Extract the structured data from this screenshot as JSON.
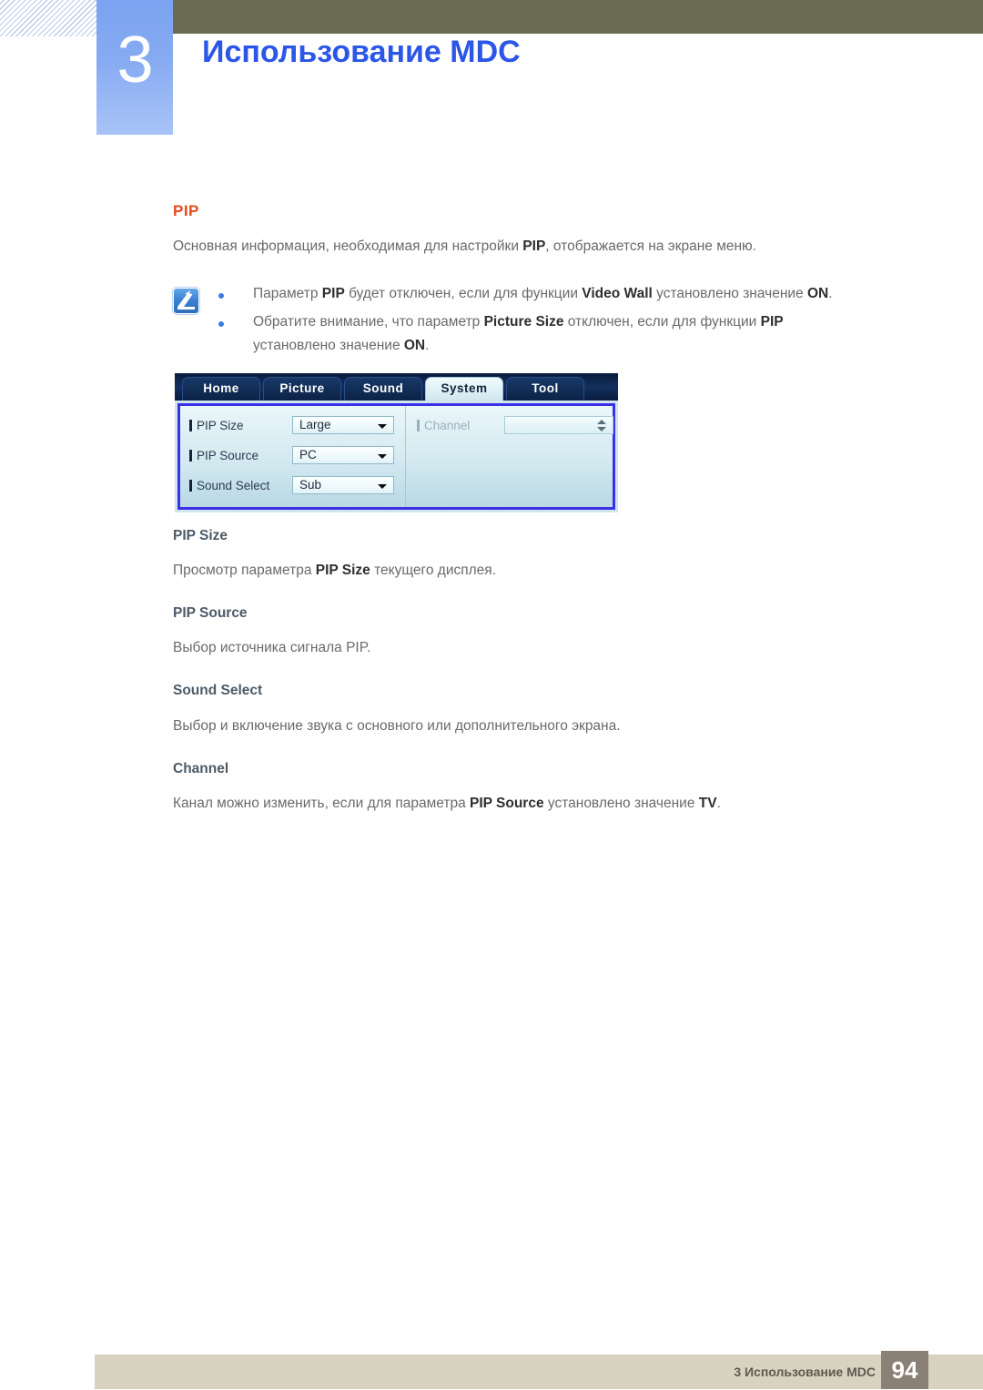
{
  "header": {
    "chapter_number": "3",
    "chapter_title": "Использование MDC",
    "accent_blue": "#2b56e8",
    "olive": "#6b6a52"
  },
  "section": {
    "title": "PIP",
    "title_color": "#e8491c",
    "intro_parts": [
      {
        "text": "Основная информация, необходимая для настройки ",
        "bold": false
      },
      {
        "text": "PIP",
        "bold": true
      },
      {
        "text": ", отображается на экране меню.",
        "bold": false
      }
    ]
  },
  "note": {
    "icon": "note-pen-icon",
    "bullet_color": "#3a7ddf",
    "items": [
      {
        "line1": [
          {
            "text": "Параметр ",
            "bold": false
          },
          {
            "text": "PIP",
            "bold": true
          },
          {
            "text": " будет отключен, если для функции ",
            "bold": false
          },
          {
            "text": "Video Wall",
            "bold": true
          },
          {
            "text": " установлено значение ",
            "bold": false
          },
          {
            "text": "ON",
            "bold": true
          },
          {
            "text": ".",
            "bold": false
          }
        ]
      },
      {
        "line1": [
          {
            "text": "Обратите внимание, что параметр ",
            "bold": false
          },
          {
            "text": "Picture Size",
            "bold": true
          },
          {
            "text": " отключен, если для функции ",
            "bold": false
          },
          {
            "text": "PIP",
            "bold": true
          }
        ],
        "line2": [
          {
            "text": "установлено значение ",
            "bold": false
          },
          {
            "text": "ON",
            "bold": true
          },
          {
            "text": ".",
            "bold": false
          }
        ]
      }
    ]
  },
  "mdc_screenshot": {
    "tabs": [
      {
        "label": "Home",
        "active": false
      },
      {
        "label": "Picture",
        "active": false
      },
      {
        "label": "Sound",
        "active": false
      },
      {
        "label": "System",
        "active": true
      },
      {
        "label": "Tool",
        "active": false
      }
    ],
    "left_fields": [
      {
        "label": "PIP Size",
        "value": "Large",
        "control": "dropdown",
        "disabled": false
      },
      {
        "label": "PIP Source",
        "value": "PC",
        "control": "dropdown",
        "disabled": false
      },
      {
        "label": "Sound Select",
        "value": "Sub",
        "control": "dropdown",
        "disabled": false
      }
    ],
    "right_fields": [
      {
        "label": "Channel",
        "value": "",
        "control": "spinner",
        "disabled": true
      }
    ],
    "panel_border_color": "#3b2fe8"
  },
  "body_sections": [
    {
      "heading": "PIP Size",
      "paragraph": [
        {
          "text": "Просмотр параметра ",
          "bold": false
        },
        {
          "text": "PIP Size",
          "bold": true
        },
        {
          "text": " текущего дисплея.",
          "bold": false
        }
      ]
    },
    {
      "heading": "PIP Source",
      "paragraph": [
        {
          "text": "Выбор источника сигнала PIP.",
          "bold": false
        }
      ]
    },
    {
      "heading": "Sound Select",
      "paragraph": [
        {
          "text": "Выбор и включение звука с основного или дополнительного экрана.",
          "bold": false
        }
      ]
    },
    {
      "heading": "Channel",
      "paragraph": [
        {
          "text": "Канал можно изменить, если для параметра ",
          "bold": false
        },
        {
          "text": "PIP Source",
          "bold": true
        },
        {
          "text": " установлено значение ",
          "bold": false
        },
        {
          "text": "TV",
          "bold": true
        },
        {
          "text": ".",
          "bold": false
        }
      ]
    }
  ],
  "footer": {
    "text": "3 Использование MDC",
    "page_number": "94"
  }
}
